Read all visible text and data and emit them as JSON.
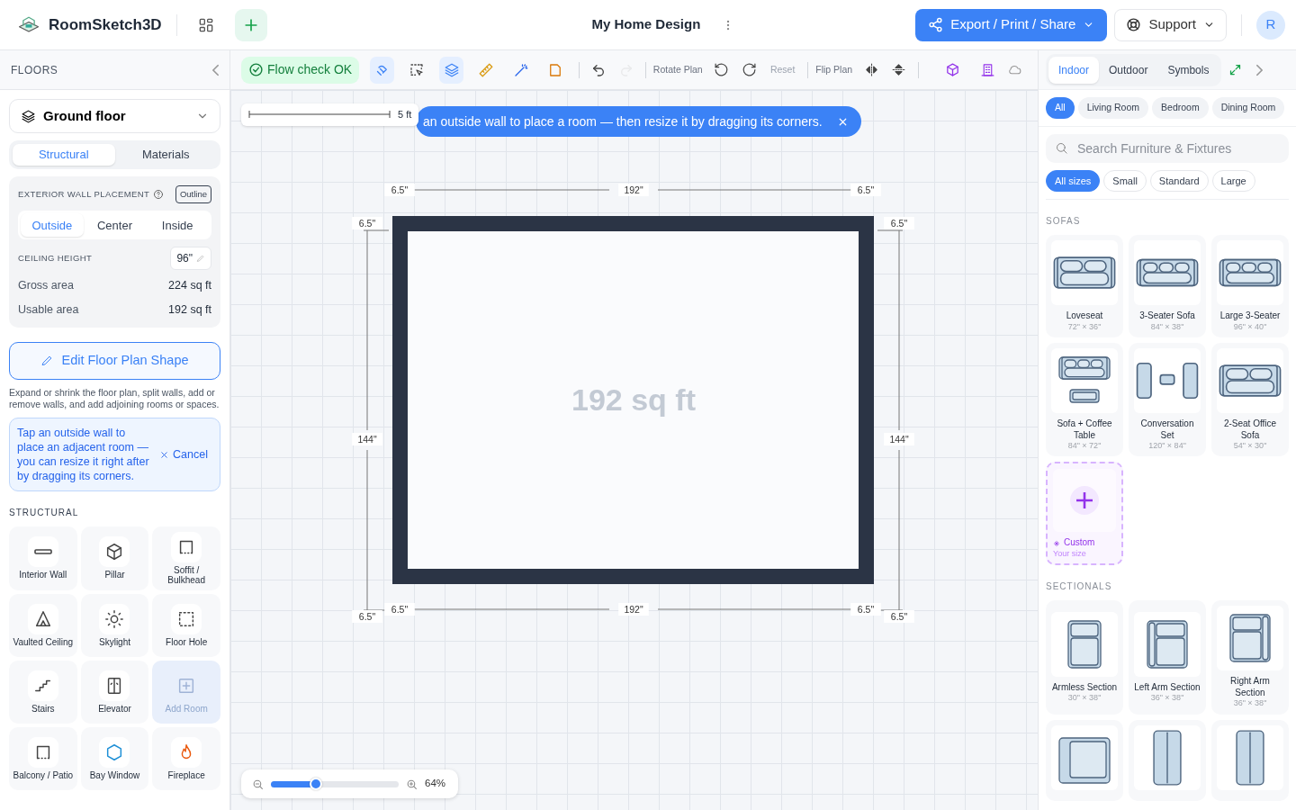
{
  "app": {
    "name": "RoomSketch3D"
  },
  "header": {
    "title": "My Home Design",
    "export_button": "Export / Print / Share",
    "support_button": "Support",
    "avatar": "R"
  },
  "left_panel": {
    "title": "FLOORS",
    "floor_select": "Ground floor",
    "tabs": [
      {
        "label": "Structural",
        "selected": true
      },
      {
        "label": "Materials",
        "selected": false
      }
    ],
    "wall_placement": {
      "label": "EXTERIOR WALL PLACEMENT",
      "badge": "Outline",
      "options": [
        {
          "label": "Outside",
          "selected": true
        },
        {
          "label": "Center",
          "selected": false
        },
        {
          "label": "Inside",
          "selected": false
        }
      ]
    },
    "ceiling": {
      "label": "CEILING HEIGHT",
      "value": "96\""
    },
    "areas": [
      {
        "label": "Gross area",
        "value": "224 sq ft"
      },
      {
        "label": "Usable area",
        "value": "192 sq ft"
      }
    ],
    "edit_button": "Edit Floor Plan Shape",
    "edit_help": "Expand or shrink the floor plan, split walls, add or remove walls, and add adjoining rooms or spaces.",
    "hint": {
      "text": "Tap an outside wall to place an adjacent room — you can resize it right after by dragging its corners.",
      "cancel": "Cancel"
    },
    "section_title": "STRUCTURAL",
    "items": [
      {
        "label": "Interior Wall",
        "kind": "wall",
        "disabled": false
      },
      {
        "label": "Pillar",
        "kind": "pillar",
        "disabled": false
      },
      {
        "label": "Soffit / Bulkhead",
        "kind": "soffit",
        "disabled": false
      },
      {
        "label": "Vaulted Ceiling",
        "kind": "vault",
        "disabled": false
      },
      {
        "label": "Skylight",
        "kind": "skylight",
        "disabled": false
      },
      {
        "label": "Floor Hole",
        "kind": "hole",
        "disabled": false
      },
      {
        "label": "Stairs",
        "kind": "stairs",
        "disabled": false
      },
      {
        "label": "Elevator",
        "kind": "elevator",
        "disabled": false
      },
      {
        "label": "Add Room",
        "kind": "addroom",
        "disabled": true
      },
      {
        "label": "Balcony / Patio",
        "kind": "balcony",
        "disabled": false
      },
      {
        "label": "Bay Window",
        "kind": "bay",
        "disabled": false
      },
      {
        "label": "Fireplace",
        "kind": "fire",
        "disabled": false
      }
    ]
  },
  "toolbar": {
    "flow_check": "Flow check OK",
    "tools": [
      {
        "kind": "magnet",
        "on": true
      },
      {
        "kind": "select",
        "on": false
      },
      {
        "kind": "layers",
        "on": true
      },
      {
        "kind": "ruler",
        "on": false
      },
      {
        "kind": "wand",
        "on": false
      },
      {
        "kind": "note",
        "on": false
      }
    ],
    "undo": {
      "disabled": false
    },
    "redo": {
      "disabled": true
    },
    "rotate_label": "Rotate Plan",
    "reset": {
      "label": "Reset",
      "disabled": true
    },
    "flip_label": "Flip Plan"
  },
  "canvas": {
    "scale": "5 ft",
    "toast": "an outside wall to place a room — then resize it by dragging its corners.",
    "area_label": "192 sq ft",
    "dimensions": {
      "top": [
        "6.5\"",
        "192\"",
        "6.5\""
      ],
      "left": [
        "6.5\"",
        "144\"",
        "6.5\""
      ],
      "right": [
        "6.5\"",
        "144\"",
        "6.5\""
      ],
      "bottom": [
        "6.5\"",
        "192\"",
        "6.5\""
      ]
    }
  },
  "zoom": {
    "level": 0.35,
    "reading": "64%"
  },
  "right_panel": {
    "tabs": [
      {
        "label": "Indoor",
        "selected": true
      },
      {
        "label": "Outdoor",
        "selected": false
      },
      {
        "label": "Symbols",
        "selected": false
      }
    ],
    "categories": [
      {
        "label": "All",
        "selected": true
      },
      {
        "label": "Living Room",
        "selected": false
      },
      {
        "label": "Bedroom",
        "selected": false
      },
      {
        "label": "Dining Room",
        "selected": false
      }
    ],
    "search": {
      "placeholder": "Search Furniture & Fixtures"
    },
    "sizes": [
      {
        "label": "All sizes",
        "selected": true
      },
      {
        "label": "Small",
        "selected": false
      },
      {
        "label": "Standard",
        "selected": false
      },
      {
        "label": "Large",
        "selected": false
      }
    ],
    "sections": [
      {
        "title": "SOFAS",
        "items": [
          {
            "kind": "sofa2",
            "name": "Loveseat",
            "size": "72\" × 36\""
          },
          {
            "kind": "sofa3",
            "name": "3-Seater Sofa",
            "size": "84\" × 38\""
          },
          {
            "kind": "sofa3",
            "name": "Large 3-Seater",
            "size": "96\" × 40\""
          },
          {
            "kind": "sofatable",
            "name": "Sofa + Coffee Table",
            "size": "84\" × 72\""
          },
          {
            "kind": "conversation",
            "name": "Conversation Set",
            "size": "120\" × 84\""
          },
          {
            "kind": "sofa2",
            "name": "2-Seat Office Sofa",
            "size": "54\" × 30\""
          },
          {
            "kind": "custom",
            "name": "Custom",
            "size": "Your size"
          }
        ]
      },
      {
        "title": "SECTIONALS",
        "items": [
          {
            "kind": "armless",
            "name": "Armless Section",
            "size": "30\" × 38\""
          },
          {
            "kind": "leftarm",
            "name": "Left Arm Section",
            "size": "36\" × 38\""
          },
          {
            "kind": "rightarm",
            "name": "Right Arm Section",
            "size": "36\" × 38\""
          },
          {
            "kind": "corner"
          },
          {
            "kind": "chaiseleft"
          },
          {
            "kind": "chaiseright"
          }
        ]
      }
    ]
  }
}
